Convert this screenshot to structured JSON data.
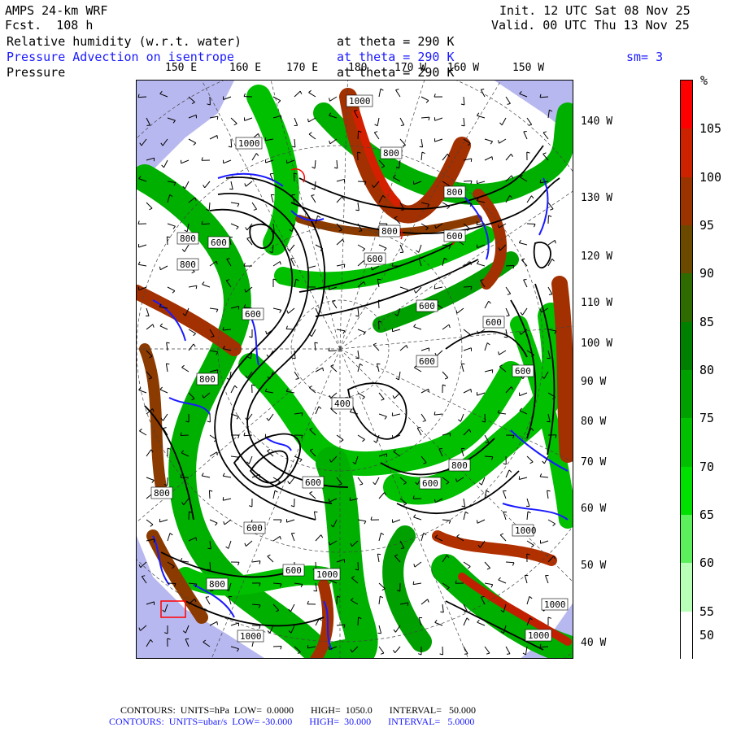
{
  "header": {
    "model": "AMPS 24-km WRF",
    "forecast": "Fcst.  108 h",
    "init": "Init. 12 UTC Sat 08 Nov 25",
    "valid": "Valid. 00 UTC Thu 13 Nov 25",
    "field1": "Relative humidity (w.r.t. water)",
    "field1_level": "at theta = 290 K",
    "field2": "Pressure Advection on isentrope",
    "field2_level": "at theta = 290 K",
    "smoothing": "sm= 3",
    "field3": "Pressure",
    "field3_level": "at theta = 290 K"
  },
  "lon_labels_top": [
    "150 E",
    "160 E",
    "170 E",
    "180",
    "170 W",
    "160 W",
    "150 W"
  ],
  "lat_labels_right": [
    "140 W",
    "130 W",
    "120 W",
    "110 W",
    "100 W",
    "90 W",
    "80 W",
    "70 W",
    "60 W",
    "50 W",
    "40 W"
  ],
  "contour_labels": [
    "1000",
    "1000",
    "800",
    "600",
    "800",
    "800",
    "600",
    "600",
    "800",
    "600",
    "600",
    "600",
    "600",
    "400",
    "800",
    "600",
    "600",
    "800",
    "600",
    "800",
    "600",
    "600",
    "800",
    "1000",
    "1000",
    "1000",
    "1000",
    "1000",
    "800"
  ],
  "colorbar": {
    "unit": "%",
    "labels": [
      "105",
      "100",
      "95",
      "90",
      "85",
      "80",
      "75",
      "70",
      "65",
      "60",
      "55",
      "50"
    ],
    "colors": [
      "#ff0000",
      "#cc2200",
      "#993300",
      "#6b4a00",
      "#2e6b00",
      "#008000",
      "#00a000",
      "#00c000",
      "#00e000",
      "#5cf05c",
      "#b8ffb8",
      "#ffffff"
    ]
  },
  "footer": {
    "line1": "CONTOURS:  UNITS=hPa  LOW=  0.0000       HIGH=  1050.0       INTERVAL=   50.000",
    "line2": "CONTOURS:  UNITS=ubar/s  LOW= -30.000       HIGH=  30.000       INTERVAL=   5.0000"
  },
  "colors": {
    "ocean": "#b8b8f0",
    "advection": "#1a1aff",
    "pressure": "#000000"
  }
}
